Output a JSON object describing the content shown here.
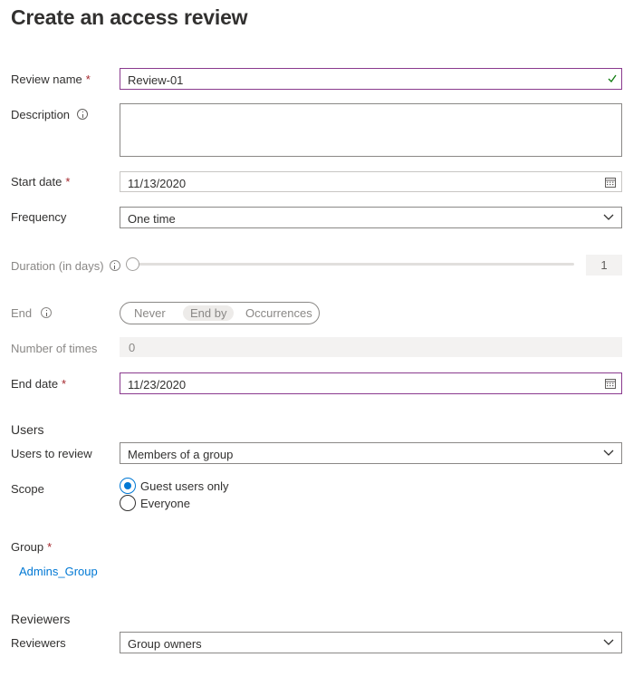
{
  "page": {
    "title": "Create an access review"
  },
  "form": {
    "review_name": {
      "label": "Review name",
      "required": "*",
      "value": "Review-01"
    },
    "description": {
      "label": "Description",
      "value": ""
    },
    "start_date": {
      "label": "Start date",
      "required": "*",
      "value": "11/13/2020"
    },
    "frequency": {
      "label": "Frequency",
      "value": "One time"
    },
    "duration": {
      "label": "Duration (in days)",
      "value": "1",
      "level": 0
    },
    "end": {
      "label": "End",
      "options": [
        "Never",
        "End by",
        "Occurrences"
      ],
      "selected": "End by"
    },
    "number_of_times": {
      "label": "Number of times",
      "value": "0"
    },
    "end_date": {
      "label": "End date",
      "required": "*",
      "value": "11/23/2020"
    }
  },
  "users": {
    "section_title": "Users",
    "users_to_review": {
      "label": "Users to review",
      "value": "Members of a group"
    },
    "scope": {
      "label": "Scope",
      "options": [
        {
          "label": "Guest users only",
          "checked": true
        },
        {
          "label": "Everyone",
          "checked": false
        }
      ]
    },
    "group": {
      "label": "Group",
      "required": "*",
      "link": "Admins_Group"
    }
  },
  "reviewers": {
    "section_title": "Reviewers",
    "reviewers": {
      "label": "Reviewers",
      "value": "Group owners"
    }
  },
  "colors": {
    "accent": "#0078d4",
    "required": "#a4262c",
    "active_border": "#8a3a8e",
    "check": "#107c10"
  }
}
